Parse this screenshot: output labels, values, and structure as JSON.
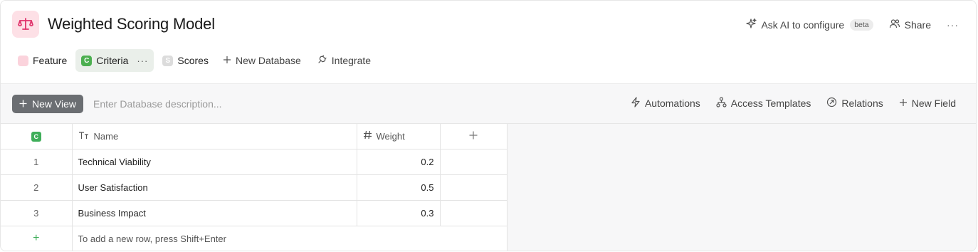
{
  "app": {
    "title": "Weighted Scoring Model",
    "icon": "balance-scale-icon"
  },
  "header_actions": {
    "ask_ai": "Ask AI to configure",
    "beta": "beta",
    "share": "Share",
    "more": "···"
  },
  "tabs": [
    {
      "label": "Feature",
      "badge": "",
      "badge_color": "#fbd3dc",
      "active": false
    },
    {
      "label": "Criteria",
      "badge": "C",
      "badge_color": "#4caf50",
      "active": true,
      "menu": "···"
    },
    {
      "label": "Scores",
      "badge": "S",
      "badge_color": "#dcdcdc",
      "active": false
    }
  ],
  "tab_actions": {
    "new_database": "New Database",
    "integrate": "Integrate"
  },
  "toolbar": {
    "new_view": "New View",
    "description_placeholder": "Enter Database description...",
    "automations": "Automations",
    "access_templates": "Access Templates",
    "relations": "Relations",
    "new_field": "New Field"
  },
  "grid": {
    "index_badge": "C",
    "columns": [
      {
        "label": "Name",
        "type": "text"
      },
      {
        "label": "Weight",
        "type": "number"
      }
    ],
    "rows": [
      {
        "index": "1",
        "name": "Technical Viability",
        "weight": "0.2"
      },
      {
        "index": "2",
        "name": "User Satisfaction",
        "weight": "0.5"
      },
      {
        "index": "3",
        "name": "Business Impact",
        "weight": "0.3"
      }
    ],
    "add_row_hint": "To add a new row, press Shift+Enter"
  },
  "colors": {
    "accent_green": "#3fae5a",
    "new_view_bg": "#6b6e72",
    "icon_bg": "#fde0e6",
    "icon_fg": "#e0336b"
  }
}
